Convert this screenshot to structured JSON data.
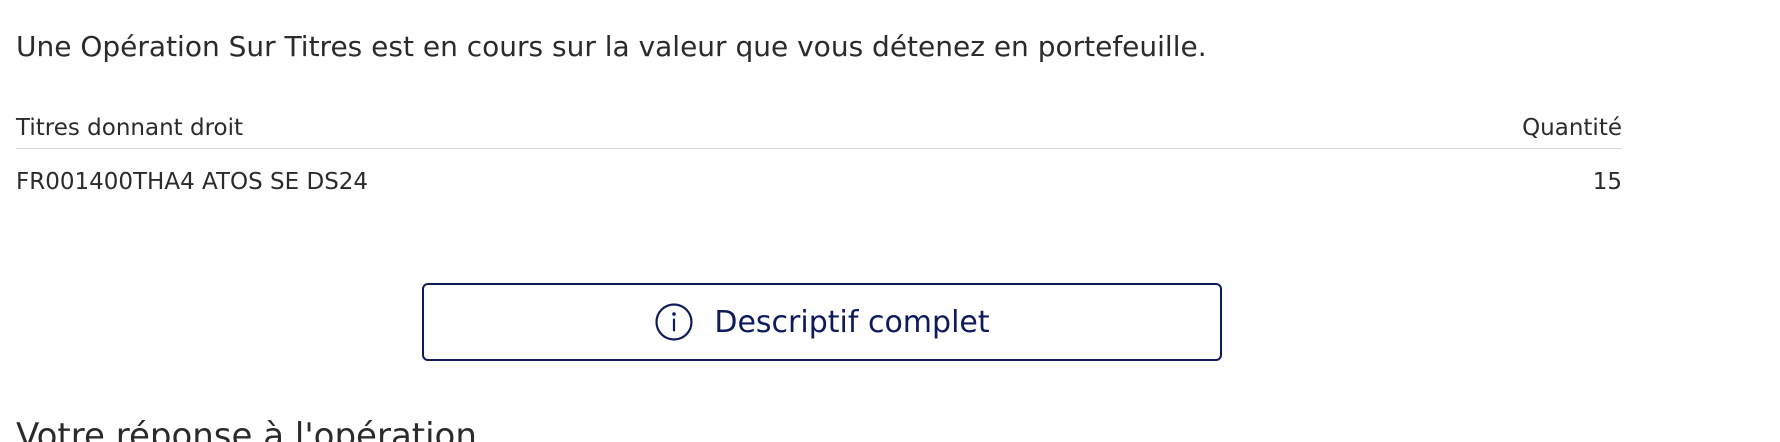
{
  "intro_text": "Une Opération Sur Titres est en cours sur la valeur que vous détenez en portefeuille.",
  "table": {
    "headers": {
      "titres": "Titres donnant droit",
      "quantite": "Quantité"
    },
    "rows": [
      {
        "titre": "FR001400THA4 ATOS SE DS24",
        "quantite": "15"
      }
    ]
  },
  "descriptif_button": {
    "label": "Descriptif complet",
    "icon": "info-icon"
  },
  "section_title": "Votre réponse à l'opération",
  "colors": {
    "accent": "#0d1a5c",
    "text": "#2b2b2b",
    "divider": "#d6d6d6"
  }
}
